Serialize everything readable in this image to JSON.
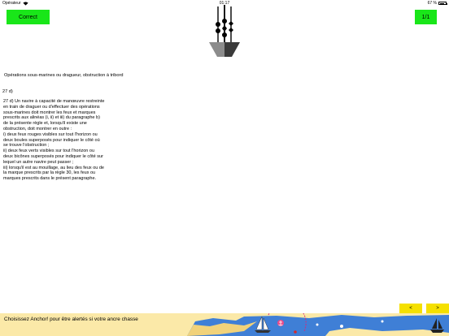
{
  "status_bar": {
    "carrier": "Opérateur",
    "time": "01:17",
    "battery": "67 %",
    "battery_level": 0.67
  },
  "toolbar": {
    "correct_label": "Correct",
    "page_label": "1/1"
  },
  "content": {
    "heading": "Opérations sous-marines ou dragueur, obstruction à tribord",
    "rule_ref": "27 d)",
    "rule_text": "27 d) Un navire à capacité de manœuvre restreinte\nen train de draguer ou d'effectuer des opérations\nsous-marines doit montrer les feux et marques\nprescrits aux alinéas (i, ii) et iii) du paragraphe b)\nde la présente règle et, lorsqu'il existe une\nobstruction, doit montrer en outre :\ni) deux feux rouges visibles sur tout l'horizon ou\ndeux boules superposés pour indiquer le côté où\nse trouve l'obstruction ;\nii) deux feux verts visibles sur tout l'horizon ou\ndeux bicônes superposés pour indiquer le côté sur\nlequel un autre navire peut passer ;\niii) lorsqu'il est au mouillage, au lieu des feux ou de\nla marque prescrits par la règle 30, les feux ou\nmarques prescrits dans le présent paragraphe."
  },
  "navigation": {
    "prev_label": "<",
    "next_label": ">"
  },
  "banner": {
    "text": "Choisissez Anchor! pour être alertés si votre ancre chasse"
  },
  "colors": {
    "accent_green": "#19e619",
    "nav_yellow": "#f5e000",
    "banner_bg": "#fbe9a8",
    "sea_blue": "#3f7fd6"
  }
}
